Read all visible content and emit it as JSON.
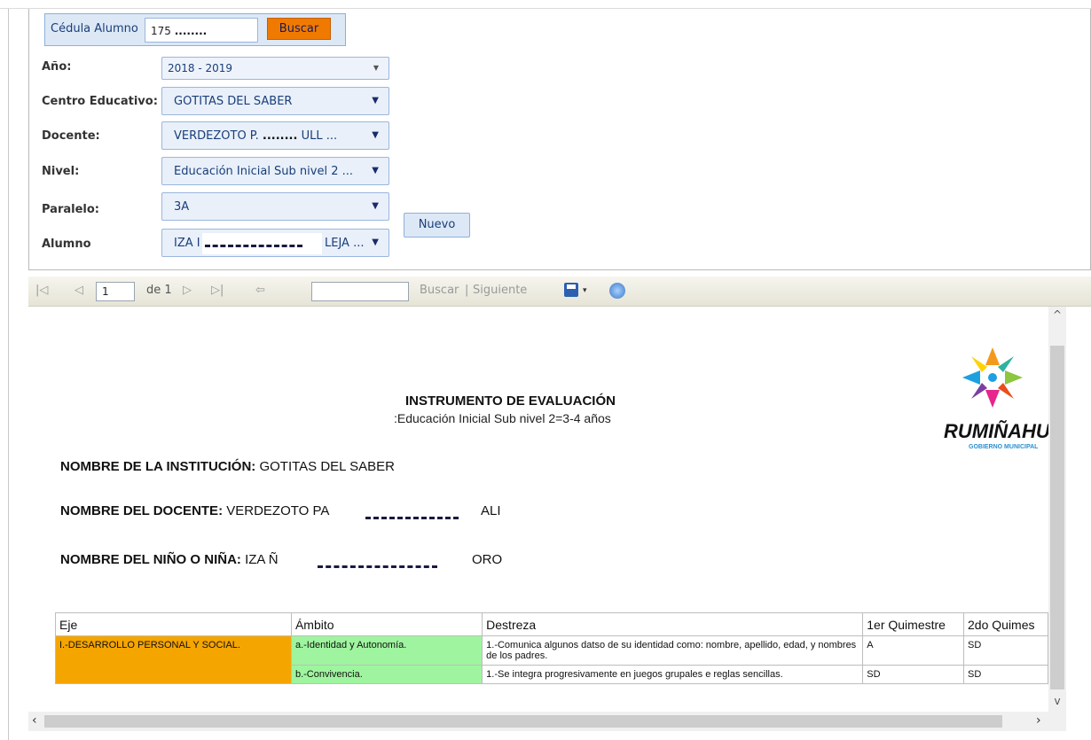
{
  "search": {
    "label": "Cédula Alumno",
    "cedula_value": "175",
    "cedula_mask": "........",
    "button": "Buscar"
  },
  "filters": {
    "anio": {
      "label": "Año:",
      "value": "2018 - 2019"
    },
    "centro": {
      "label": "Centro Educativo:",
      "value": "GOTITAS DEL SABER"
    },
    "docente": {
      "label": "Docente:",
      "value_prefix": "VERDEZOTO P.",
      "value_mask": "........",
      "value_suffix": "ULL ..."
    },
    "nivel": {
      "label": "Nivel:",
      "value": "Educación Inicial Sub nivel 2 ..."
    },
    "paralelo": {
      "label": "Paralelo:",
      "value": "3A"
    },
    "alumno": {
      "label": "Alumno",
      "value_prefix": "IZA I",
      "value_suffix": "LEJA ..."
    },
    "nuevo_button": "Nuevo"
  },
  "toolbar": {
    "first_icon": "first-page-icon",
    "prev_icon": "previous-page-icon",
    "page_value": "1",
    "page_of": "de 1",
    "next_icon": "next-page-icon",
    "last_icon": "last-page-icon",
    "back_icon": "back-icon",
    "find_label": "Buscar",
    "separator": "|",
    "next_label": "Siguiente",
    "save_icon": "save-icon",
    "refresh_icon": "refresh-icon"
  },
  "report": {
    "title": "INSTRUMENTO DE EVALUACIÓN",
    "subtitle": ":Educación Inicial Sub nivel 2=3-4 años",
    "institucion_label": "NOMBRE DE LA INSTITUCIÓN:",
    "institucion_value": "GOTITAS DEL SABER",
    "docente_label": "NOMBRE DEL DOCENTE:",
    "docente_value_prefix": "VERDEZOTO PA",
    "docente_value_suffix": "ALI",
    "nino_label": "NOMBRE DEL NIÑO O NIÑA:",
    "nino_value_prefix": "IZA Ñ",
    "nino_value_suffix": "ORO",
    "logo_text": "RUMIÑAHU",
    "logo_sub": "GOBIERNO MUNICIPAL",
    "table": {
      "headers": [
        "Eje",
        "Ámbito",
        "Destreza",
        "1er Quimestre",
        "2do Quimes"
      ],
      "rows": [
        {
          "eje": "I.-DESARROLLO PERSONAL Y SOCIAL.",
          "ambito": "a.-Identidad y Autonomía.",
          "destreza": "1.-Comunica algunos datso de su identidad como: nombre, apellido, edad, y nombres de los padres.",
          "q1": "A",
          "q2": "SD"
        },
        {
          "eje": "",
          "ambito": "b.-Convivencia.",
          "destreza": "1.-Se integra progresivamente en juegos grupales  e reglas sencillas.",
          "q1": "SD",
          "q2": "SD"
        }
      ]
    }
  },
  "colors": {
    "accent_button": "#f07a00",
    "eje_cell": "#f5a500",
    "ambito_cell": "#9ff59f",
    "combo_bg": "#e9f0fa"
  }
}
